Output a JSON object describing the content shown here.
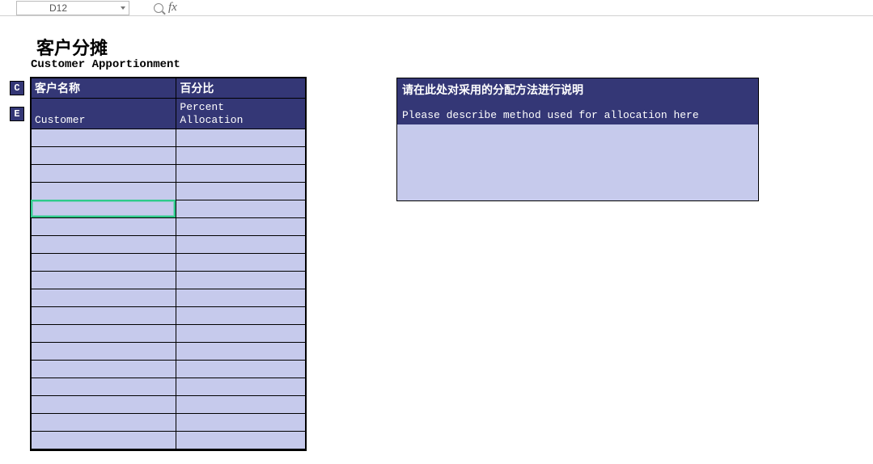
{
  "formula_bar": {
    "cell_ref": "D12",
    "fx_label": "fx"
  },
  "titles": {
    "cn": "客户分摊",
    "en": "Customer Apportionment"
  },
  "tags": {
    "c": "C",
    "e": "E"
  },
  "table": {
    "headers": {
      "customer_cn": "客户名称",
      "percent_cn": "百分比",
      "customer_en": "Customer",
      "percent_en_line1": "Percent",
      "percent_en_line2": "Allocation"
    },
    "rows": [
      {
        "customer": "",
        "percent": ""
      },
      {
        "customer": "",
        "percent": ""
      },
      {
        "customer": "",
        "percent": ""
      },
      {
        "customer": "",
        "percent": ""
      },
      {
        "customer": "",
        "percent": ""
      },
      {
        "customer": "",
        "percent": ""
      },
      {
        "customer": "",
        "percent": ""
      },
      {
        "customer": "",
        "percent": ""
      },
      {
        "customer": "",
        "percent": ""
      },
      {
        "customer": "",
        "percent": ""
      },
      {
        "customer": "",
        "percent": ""
      },
      {
        "customer": "",
        "percent": ""
      },
      {
        "customer": "",
        "percent": ""
      },
      {
        "customer": "",
        "percent": ""
      },
      {
        "customer": "",
        "percent": ""
      },
      {
        "customer": "",
        "percent": ""
      },
      {
        "customer": "",
        "percent": ""
      },
      {
        "customer": "",
        "percent": ""
      }
    ],
    "selected_row_index": 4,
    "selected_col": "customer"
  },
  "description_box": {
    "cn": "请在此处对采用的分配方法进行说明",
    "en": "Please describe method used for allocation here",
    "body": ""
  }
}
